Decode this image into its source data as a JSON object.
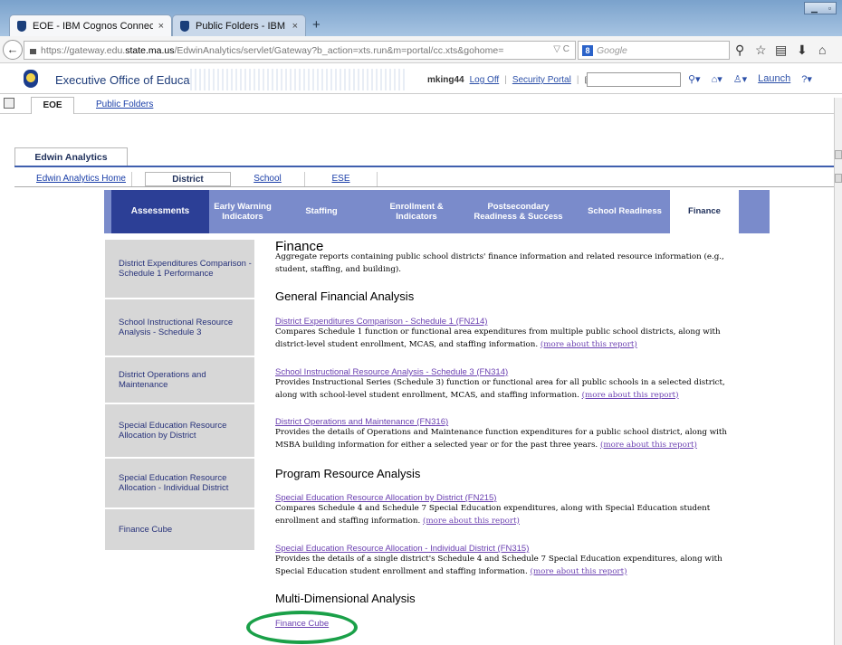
{
  "browser": {
    "tabs": [
      {
        "title": "EOE - IBM Cognos Connec...",
        "close": "×"
      },
      {
        "title": "Public Folders - IBM Cogn...",
        "close": "×"
      }
    ],
    "new_tab": "+",
    "url_prefix": "https://gateway.edu.",
    "url_domain": "state.ma.us",
    "url_rest": "/EdwinAnalytics/servlet/Gateway?b_action=xts.run&m=portal/cc.xts&gohome=",
    "url_controls": "▽ C",
    "search_engine_badge": "8",
    "search_placeholder": "Google",
    "back_glyph": "←",
    "nav_icons": [
      "search-icon",
      "star-icon",
      "bookmarks-icon",
      "download-icon",
      "home-icon"
    ]
  },
  "header": {
    "org_name": "Executive Office of Education",
    "username": "mking44",
    "log_off": "Log Off",
    "security_portal": "Security Portal",
    "launch": "Launch"
  },
  "portal_tabs": {
    "eoe": "EOE",
    "public_folders": "Public Folders"
  },
  "edwin": {
    "title": "Edwin Analytics",
    "subtabs": [
      "Edwin Analytics Home",
      "District",
      "School",
      "ESE"
    ],
    "categories": [
      "Assessments",
      "Early Warning Indicators",
      "Staffing",
      "Enrollment & Indicators",
      "Postsecondary Readiness & Success",
      "School Readiness",
      "Finance"
    ]
  },
  "left_menu": [
    "District Expenditures Comparison - Schedule 1 Performance",
    "School Instructional Resource Analysis - Schedule 3",
    "District Operations and Maintenance",
    "Special Education Resource Allocation by District",
    "Special Education Resource Allocation - Individual District",
    "Finance Cube"
  ],
  "content": {
    "title": "Finance",
    "intro": "Aggregate reports containing public school districts' finance information and related resource information (e.g., student, staffing, and building).",
    "more_label": "(more about this report)",
    "sections": [
      {
        "heading": "General Financial Analysis",
        "reports": [
          {
            "link": "District Expenditures Comparison - Schedule 1 (FN214)",
            "desc": "Compares Schedule 1 function or functional area expenditures from multiple public school districts, along with district-level student enrollment, MCAS, and staffing information."
          },
          {
            "link": "School Instructional Resource Analysis - Schedule 3 (FN314)",
            "desc": "Provides Instructional Series (Schedule 3) function or functional area for all public schools in a selected district, along with school-level student enrollment, MCAS, and staffing information."
          },
          {
            "link": "District Operations and Maintenance (FN316)",
            "desc": "Provides the details of Operations and Maintenance function expenditures for a public school district, along with MSBA building information for either a selected year or for the past three years."
          }
        ]
      },
      {
        "heading": "Program Resource Analysis",
        "reports": [
          {
            "link": "Special Education Resource Allocation by District (FN215)",
            "desc": "Compares Schedule 4 and Schedule 7 Special Education expenditures, along with Special Education student enrollment and staffing information."
          },
          {
            "link": "Special Education Resource Allocation - Individual District (FN315)",
            "desc": "Provides the details of a single district's Schedule 4 and Schedule 7 Special Education expenditures, along with Special Education student enrollment and staffing information."
          }
        ]
      },
      {
        "heading": "Multi-Dimensional Analysis",
        "reports": [
          {
            "link": "Finance Cube",
            "desc": ""
          }
        ]
      }
    ]
  },
  "colors": {
    "category_bar": "#7a8bcb",
    "active_category": "#2c3f96",
    "annotation_circle": "#1aa048",
    "link": "#6a3fb0"
  }
}
